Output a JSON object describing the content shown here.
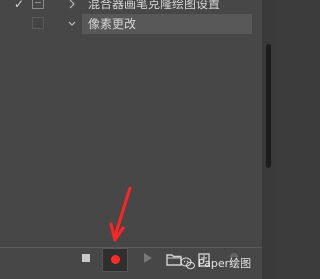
{
  "rows": [
    {
      "check": "✓",
      "label": "混合器画笔克隆绘图设置"
    },
    {
      "label": "像素更改"
    }
  ],
  "icons": {
    "checkmark": "check-icon",
    "expand_collapsed": "chevron-right-icon",
    "expand_open": "chevron-down-icon",
    "stop": "stop-icon",
    "record": "record-icon",
    "play": "play-icon",
    "new_set": "folder-icon",
    "new_action": "new-action-icon",
    "delete": "trash-icon",
    "watermark": "wechat-icon"
  },
  "colors": {
    "record": "#ff2b2b",
    "arrow": "#ff2323",
    "panel": "#474747",
    "selected_row": "#585858"
  },
  "watermark": {
    "text": "Paper绘图"
  }
}
